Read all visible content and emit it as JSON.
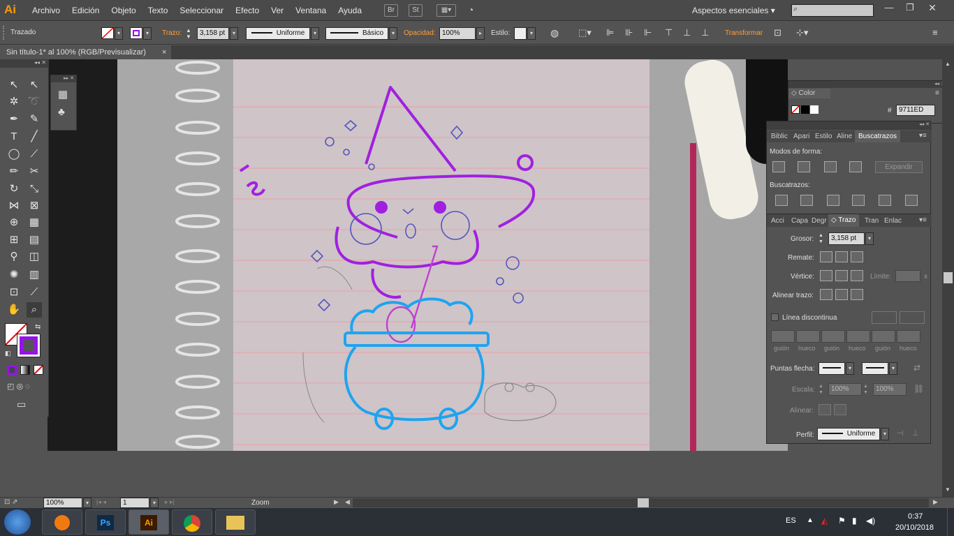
{
  "menubar": {
    "logo": "Ai",
    "items": [
      "Archivo",
      "Edición",
      "Objeto",
      "Texto",
      "Seleccionar",
      "Efecto",
      "Ver",
      "Ventana",
      "Ayuda"
    ],
    "icon_br": "Br",
    "icon_st": "St",
    "workspace": "Aspectos esenciales",
    "search_value": ""
  },
  "control": {
    "selection_type": "Trazado",
    "trazo_label": "Trazo:",
    "stroke_weight": "3,158 pt",
    "profile": "Uniforme",
    "brush": "Básico",
    "opacity_label": "Opacidad:",
    "opacity": "100%",
    "style_label": "Estilo:",
    "transform_label": "Transformar"
  },
  "document": {
    "tab_title": "Sin título-1* al 100% (RGB/Previsualizar)",
    "close": "×"
  },
  "colors": {
    "fill": "#ffffff",
    "stroke": "#9711ED",
    "hex_value": "9711ED",
    "hat": "#a020e0",
    "cauldron": "#1ea4f0",
    "spoon": "#c040d0"
  },
  "color_panel": {
    "title": "Color",
    "hash": "#",
    "hex": "9711ED"
  },
  "pathfinder_panel": {
    "tabs": [
      "Biblic",
      "Apari",
      "Estilo",
      "Aline",
      "Buscatrazos"
    ],
    "modes_label": "Modos de forma:",
    "expand_label": "Expandir",
    "pathfinders_label": "Buscatrazos:"
  },
  "stroke_panel": {
    "tabs": [
      "Acci",
      "Capa",
      "Degr",
      "Trazo",
      "Tran",
      "Enlac"
    ],
    "weight_label": "Grosor:",
    "weight": "3,158 pt",
    "cap_label": "Remate:",
    "corner_label": "Vértice:",
    "limit_label": "Límite:",
    "limit_x": "x",
    "align_label": "Alinear trazo:",
    "dashed_label": "Línea discontinua",
    "dash_labels": [
      "guión",
      "hueco",
      "guión",
      "hueco",
      "guión",
      "hueco"
    ],
    "arrowheads_label": "Puntas flecha:",
    "scale_label": "Escala:",
    "scale1": "100%",
    "scale2": "100%",
    "align_arrows_label": "Alinear:",
    "profile_label": "Perfil:",
    "profile": "Uniforme"
  },
  "status": {
    "zoom": "100%",
    "artboard": "1",
    "tool_name": "Zoom"
  },
  "taskbar": {
    "lang": "ES",
    "time": "0:37",
    "date": "20/10/2018",
    "ps_label": "Ps",
    "ai_label": "Ai"
  }
}
